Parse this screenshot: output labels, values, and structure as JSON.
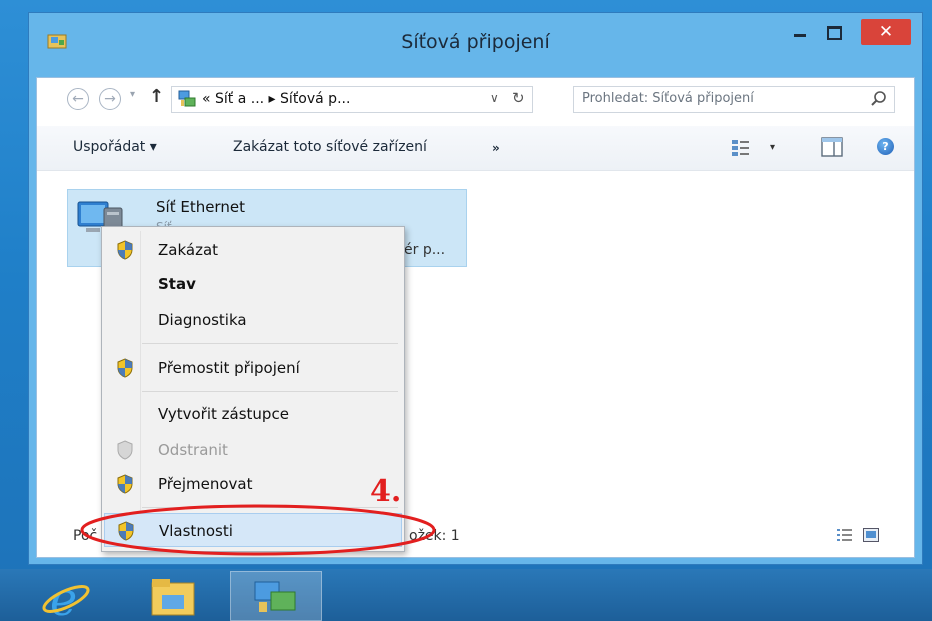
{
  "window": {
    "title": "Síťová připojení",
    "close_glyph": "✕"
  },
  "nav": {
    "back_glyph": "←",
    "forward_glyph": "→",
    "recent_glyph": "▾",
    "up_glyph": "↑",
    "breadcrumb": "« Síť a ... ▸ Síťová p...",
    "dropdown_glyph": "∨",
    "refresh_glyph": "↻",
    "search_placeholder": "Prohledat: Síťová připojení"
  },
  "toolbar": {
    "organize_label": "Uspořádat ▾",
    "disable_device_label": "Zakázat toto síťové zařízení",
    "more_label": "»",
    "view_dropdown_glyph": "▾",
    "help_glyph": "?"
  },
  "connection": {
    "name": "Síť Ethernet",
    "status_partial": "Síť",
    "adapter_partial": "ér p..."
  },
  "status": {
    "count_label_partial": "Poč",
    "count_value_partial": "ožek: 1"
  },
  "context_menu": {
    "items": [
      {
        "label": "Zakázat",
        "shield": true,
        "bold": false,
        "disabled": false
      },
      {
        "label": "Stav",
        "shield": false,
        "bold": true,
        "disabled": false
      },
      {
        "label": "Diagnostika",
        "shield": false,
        "bold": false,
        "disabled": false
      },
      {
        "label": "Přemostit připojení",
        "shield": true,
        "bold": false,
        "disabled": false
      },
      {
        "label": "Vytvořit zástupce",
        "shield": false,
        "bold": false,
        "disabled": false
      },
      {
        "label": "Odstranit",
        "shield": true,
        "bold": false,
        "disabled": true
      },
      {
        "label": "Přejmenovat",
        "shield": true,
        "bold": false,
        "disabled": false
      },
      {
        "label": "Vlastnosti",
        "shield": true,
        "bold": false,
        "disabled": false,
        "highlighted": true
      }
    ]
  },
  "annotation": {
    "step": "4.",
    "color": "#e21f1f"
  },
  "colors": {
    "close_button": "#d9443a",
    "menu_highlight": "#d5e7f8",
    "selection": "#cce6f7"
  },
  "taskbar": {
    "apps": [
      "internet-explorer-icon",
      "file-explorer-icon",
      "network-connections-icon"
    ]
  }
}
